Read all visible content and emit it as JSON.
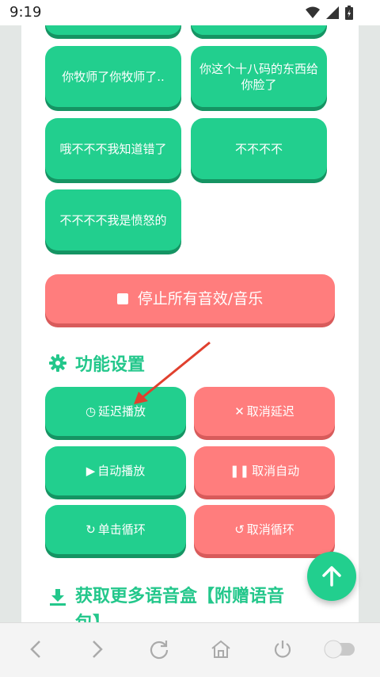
{
  "status": {
    "time": "9:19"
  },
  "soundboard": {
    "items": [
      {
        "label": ""
      },
      {
        "label": ""
      },
      {
        "label": "你牧师了你牧师了.."
      },
      {
        "label": "你这个十八码的东西给你脸了"
      },
      {
        "label": "哦不不不我知道错了"
      },
      {
        "label": "不不不不"
      },
      {
        "label": "不不不不我是愤怒的"
      }
    ],
    "stop_all_label": "停止所有音效/音乐"
  },
  "settings": {
    "title": "功能设置",
    "delay_play": "延迟播放",
    "cancel_delay": "取消延迟",
    "auto_play": "自动播放",
    "cancel_auto": "取消自动",
    "single_loop": "单击循环",
    "cancel_loop": "取消循环"
  },
  "more": {
    "title": "获取更多语音盒【附赠语音包】"
  },
  "colors": {
    "green": "#22cf8e",
    "red": "#ff7d7d",
    "title_green": "#23c78b",
    "arrow": "#e0402e"
  }
}
